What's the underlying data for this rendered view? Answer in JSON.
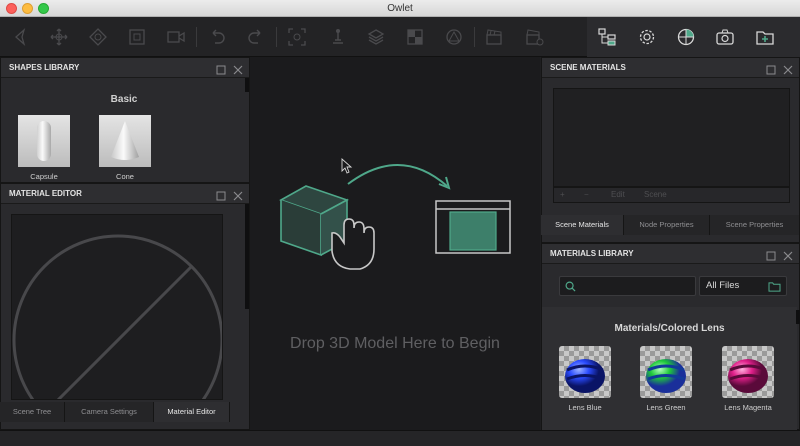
{
  "window": {
    "title": "Owlet"
  },
  "toolbar": {
    "left_tools": [
      "arrow-left-icon",
      "move-icon",
      "rotate-icon",
      "scale-icon",
      "camera-frame-icon",
      "undo-icon",
      "redo-icon",
      "focus-icon",
      "pin-icon",
      "layers-icon",
      "checker-icon",
      "triangle-icon",
      "clapper-icon",
      "clapper-add-icon"
    ],
    "right_tools": [
      "scene-tree-icon",
      "gear-icon",
      "globe-icon",
      "camera-icon",
      "folder-add-icon"
    ]
  },
  "shapes_library": {
    "title": "SHAPES LIBRARY",
    "section": "Basic",
    "items": [
      {
        "label": "Capsule"
      },
      {
        "label": "Cone"
      }
    ]
  },
  "material_editor": {
    "title": "MATERIAL EDITOR"
  },
  "left_tabs": [
    {
      "label": "Scene Tree",
      "active": false
    },
    {
      "label": "Camera Settings",
      "active": false
    },
    {
      "label": "Material Editor",
      "active": true
    }
  ],
  "viewport": {
    "drop_text": "Drop 3D Model Here to Begin"
  },
  "scene_materials": {
    "title": "SCENE MATERIALS",
    "buttons": {
      "add": "+",
      "remove": "−",
      "edit": "Edit",
      "scene": "Scene"
    }
  },
  "right_tabs": [
    {
      "label": "Scene Materials",
      "active": true
    },
    {
      "label": "Node Properties",
      "active": false
    },
    {
      "label": "Scene Properties",
      "active": false
    }
  ],
  "materials_library": {
    "title": "MATERIALS LIBRARY",
    "search_placeholder": "",
    "filter": "All Files",
    "category": "Materials/Colored Lens",
    "items": [
      {
        "label": "Lens Blue",
        "color": "#2a4bff"
      },
      {
        "label": "Lens Green",
        "color": "#1ec93a"
      },
      {
        "label": "Lens Magenta",
        "color": "#e0208a"
      }
    ]
  },
  "colors": {
    "accent": "#4fa88a",
    "background": "#1e1e20"
  }
}
